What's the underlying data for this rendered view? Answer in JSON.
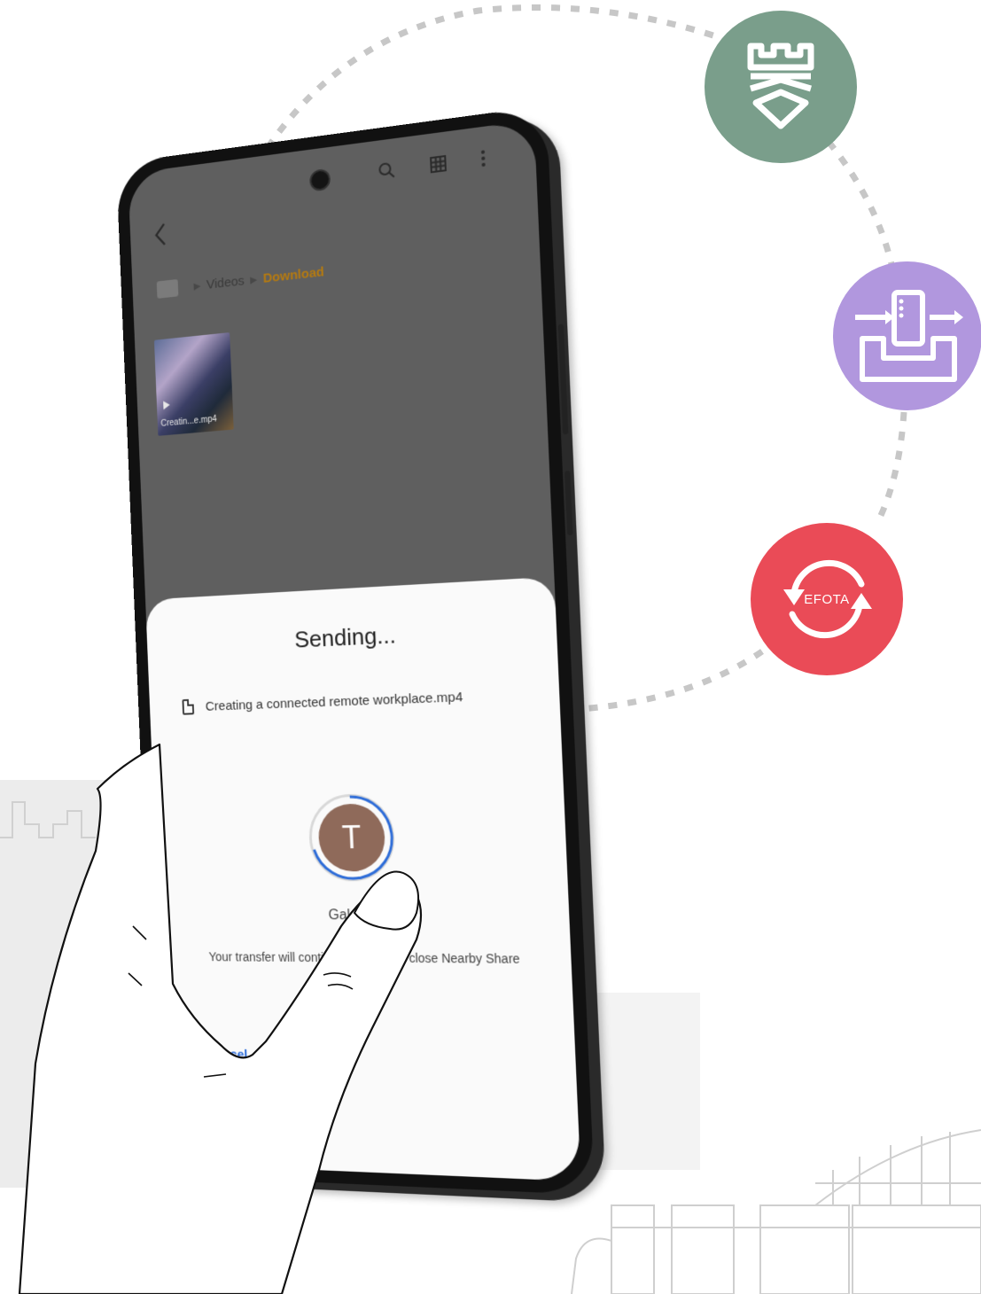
{
  "app": {
    "breadcrumb": [
      "Videos",
      "Download"
    ],
    "top_icons": [
      "search-icon",
      "grid-view-icon",
      "more-options-icon"
    ],
    "thumbnail_label": "Creatin...e.mp4"
  },
  "share_sheet": {
    "title": "Sending...",
    "file_name": "Creating a connected remote workplace.mp4",
    "avatar_initial": "T",
    "device_name": "Galaxy S",
    "transfer_note": "Your transfer will contin",
    "transfer_note_end": "close Nearby Share",
    "cancel_label": "Cancel",
    "avatar_color": "#8f6a5a",
    "accent_color": "#2d6cd8"
  },
  "features": [
    {
      "name": "knox-security",
      "icon": "shield-castle-icon",
      "color": "#7a9e8b"
    },
    {
      "name": "knox-deployment",
      "icon": "phone-in-box-icon",
      "color": "#b197de"
    },
    {
      "name": "efota",
      "label": "EFOTA",
      "icon": "sync-arrows-icon",
      "color": "#ea4b57"
    }
  ]
}
